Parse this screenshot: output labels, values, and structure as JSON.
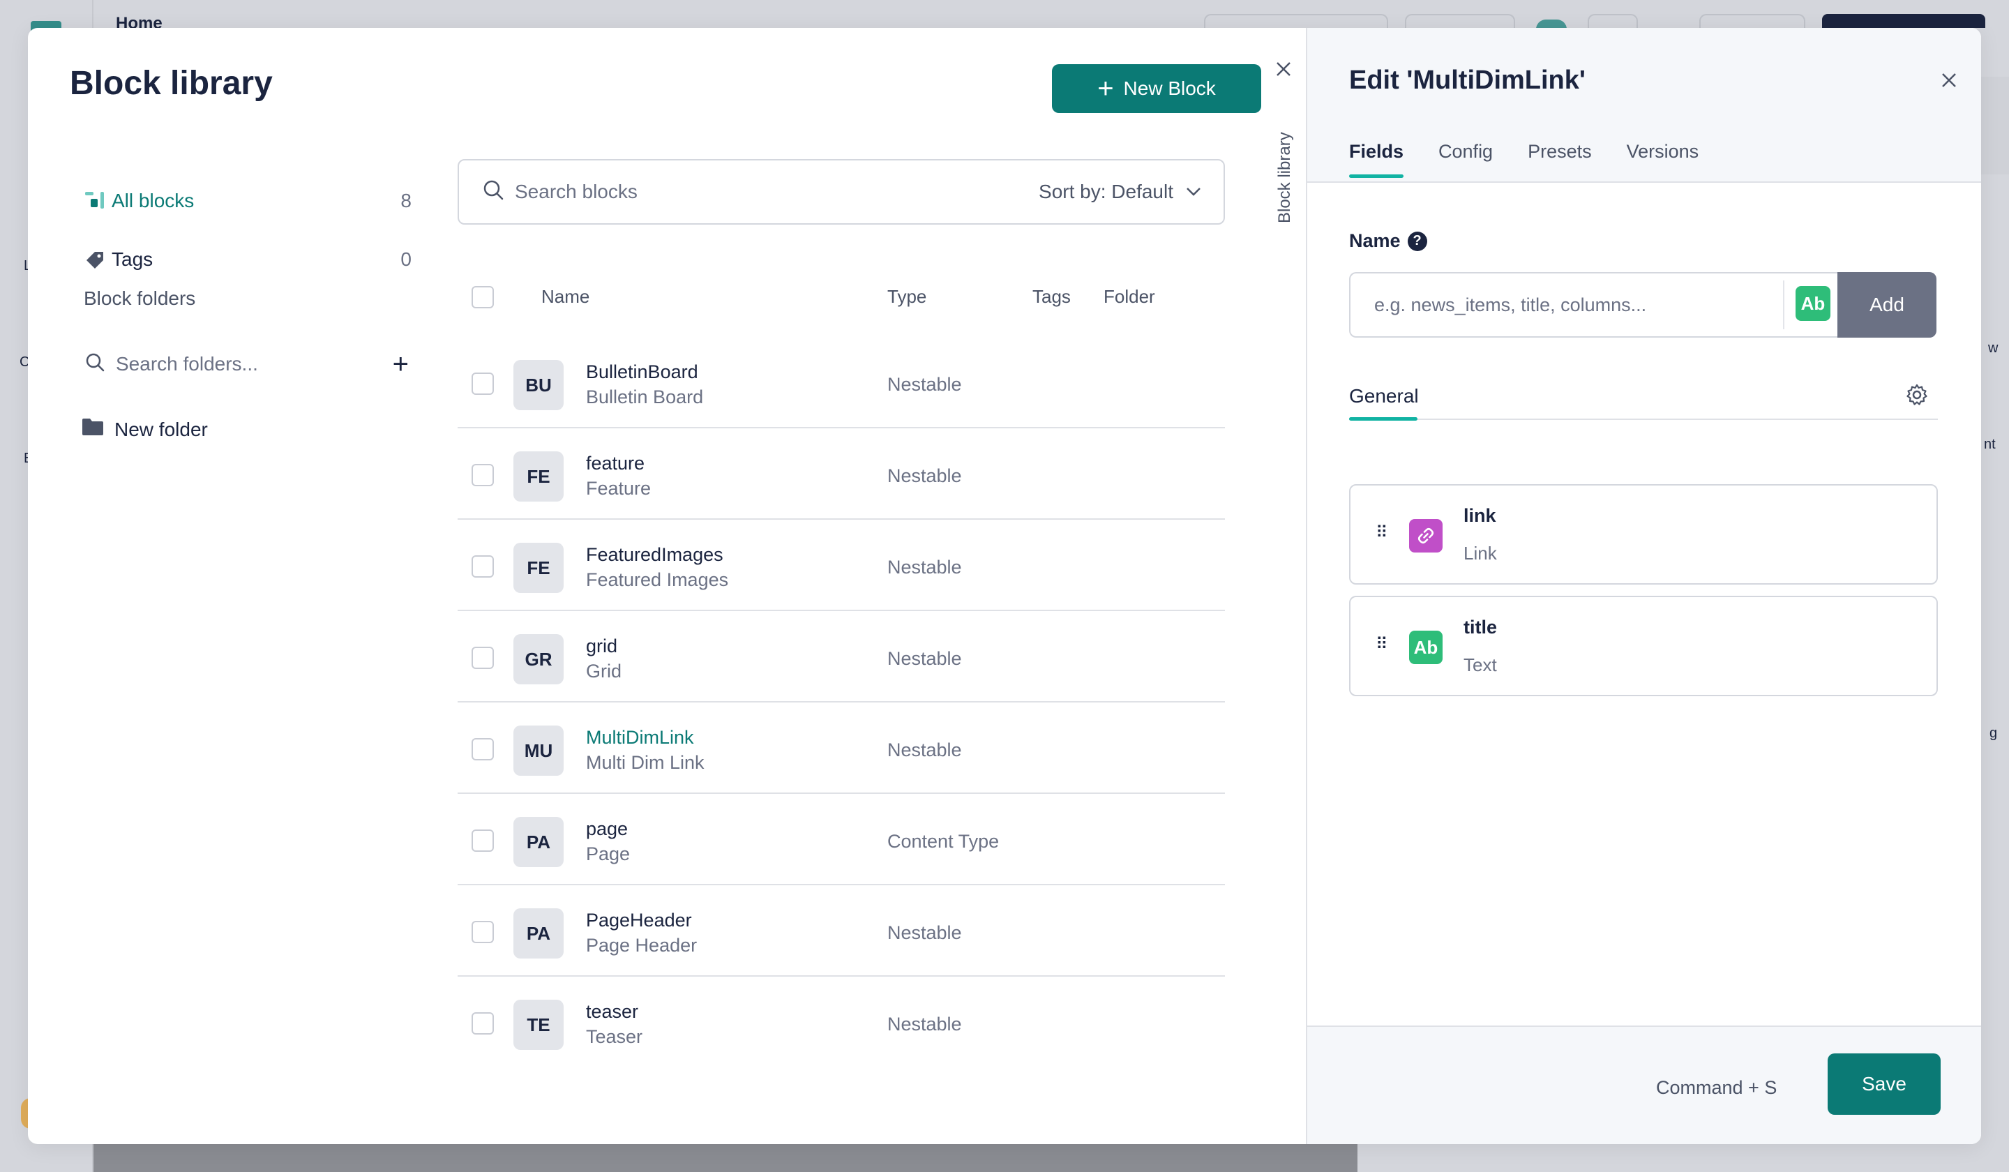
{
  "background": {
    "header_title": "Home",
    "side_fragments": [
      "L",
      "C",
      "E"
    ],
    "right_fragments": [
      "w",
      "nt",
      "g"
    ]
  },
  "library": {
    "title": "Block library",
    "new_block_label": "New Block",
    "nav": {
      "all_blocks_label": "All blocks",
      "all_blocks_count": "8",
      "tags_label": "Tags",
      "tags_count": "0",
      "folders_heading": "Block folders",
      "folder_search_placeholder": "Search folders...",
      "new_folder_label": "New folder"
    },
    "search_placeholder": "Search blocks",
    "sort_label": "Sort by: Default",
    "columns": {
      "name": "Name",
      "type": "Type",
      "tags": "Tags",
      "folder": "Folder"
    },
    "rows": [
      {
        "abbr": "BU",
        "name": "BulletinBoard",
        "display": "Bulletin Board",
        "type": "Nestable"
      },
      {
        "abbr": "FE",
        "name": "feature",
        "display": "Feature",
        "type": "Nestable"
      },
      {
        "abbr": "FE",
        "name": "FeaturedImages",
        "display": "Featured Images",
        "type": "Nestable"
      },
      {
        "abbr": "GR",
        "name": "grid",
        "display": "Grid",
        "type": "Nestable"
      },
      {
        "abbr": "MU",
        "name": "MultiDimLink",
        "display": "Multi Dim Link",
        "type": "Nestable"
      },
      {
        "abbr": "PA",
        "name": "page",
        "display": "Page",
        "type": "Content Type"
      },
      {
        "abbr": "PA",
        "name": "PageHeader",
        "display": "Page Header",
        "type": "Nestable"
      },
      {
        "abbr": "TE",
        "name": "teaser",
        "display": "Teaser",
        "type": "Nestable"
      }
    ],
    "vertical_tab_label": "Block library"
  },
  "edit": {
    "title": "Edit 'MultiDimLink'",
    "tabs": [
      "Fields",
      "Config",
      "Presets",
      "Versions"
    ],
    "name_label": "Name",
    "name_placeholder": "e.g. news_items, title, columns...",
    "type_badge": "Ab",
    "add_label": "Add",
    "group_label": "General",
    "fields": [
      {
        "name": "link",
        "type": "Link",
        "icon": "link-icon",
        "color": "#c04fc8"
      },
      {
        "name": "title",
        "type": "Text",
        "icon": "Ab",
        "color": "#2ebd79"
      }
    ],
    "shortcut_hint": "Command + S",
    "save_label": "Save"
  },
  "colors": {
    "accent": "#0b7a75",
    "tab_underline": "#11b3a3",
    "text_field_badge": "#2ebd79",
    "link_field_badge": "#c04fc8"
  }
}
